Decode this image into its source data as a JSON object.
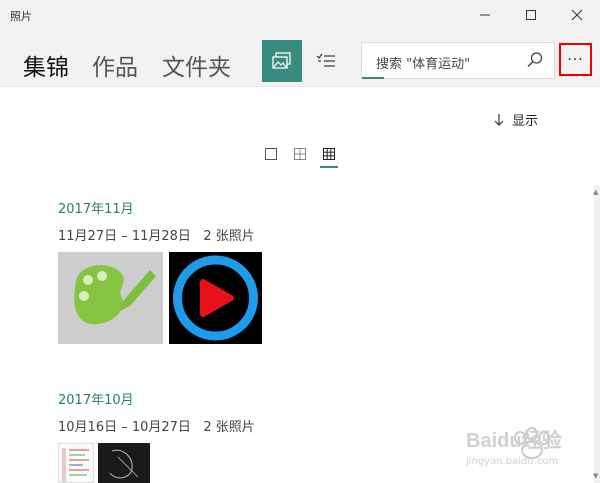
{
  "window": {
    "title": "照片"
  },
  "tabs": [
    {
      "label": "集锦",
      "active": true
    },
    {
      "label": "作品",
      "active": false
    },
    {
      "label": "文件夹",
      "active": false
    }
  ],
  "search": {
    "placeholder": "搜索 \"体育运动\""
  },
  "more_label": "···",
  "show_label": "显示",
  "groups": [
    {
      "month": "2017年11月",
      "range": "11月27日 – 11月28日",
      "count": "2 张照片"
    },
    {
      "month": "2017年10月",
      "range": "10月16日 – 10月27日",
      "count": "2 张照片"
    }
  ],
  "watermark": {
    "brand": "Baidu经验",
    "url": "jingyan.baidu.com"
  },
  "colors": {
    "accent": "#3a8b7f",
    "highlight": "#e00000",
    "month_text": "#2a7b6f"
  },
  "icons": [
    "minimize-icon",
    "maximize-icon",
    "close-icon",
    "album-view-icon",
    "select-list-icon",
    "search-icon",
    "download-arrow-icon",
    "single-square-icon",
    "grid-2-icon",
    "grid-3-icon"
  ]
}
